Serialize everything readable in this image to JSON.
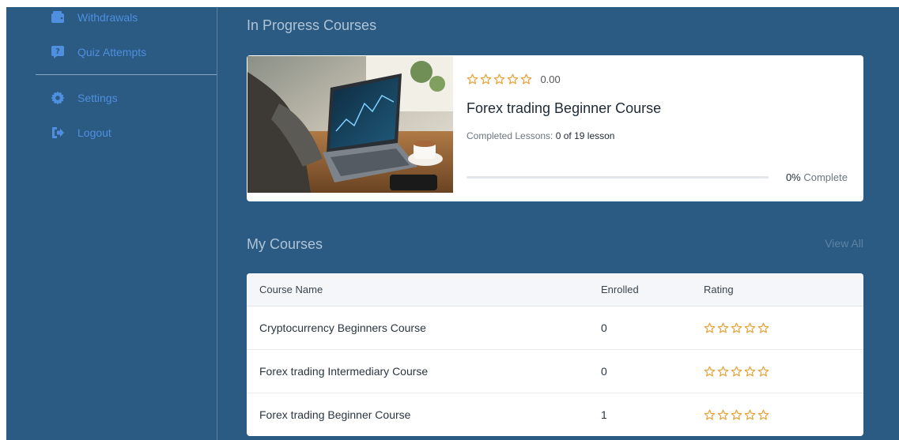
{
  "sidebar": {
    "items": [
      {
        "label": "Withdrawals",
        "icon": "wallet-icon"
      },
      {
        "label": "Quiz Attempts",
        "icon": "quiz-icon"
      },
      {
        "label": "Settings",
        "icon": "gear-icon"
      },
      {
        "label": "Logout",
        "icon": "logout-icon"
      }
    ]
  },
  "in_progress": {
    "title": "In Progress Courses",
    "course": {
      "rating_stars": 0,
      "rating_value": "0.00",
      "title": "Forex trading Beginner Course",
      "lessons_label": "Completed Lessons:",
      "lessons_value": "0 of 19 lesson",
      "progress_percent": 0,
      "progress_pct_text": "0%",
      "progress_suffix": "Complete"
    }
  },
  "my_courses": {
    "title": "My Courses",
    "view_all": "View All",
    "columns": [
      "Course Name",
      "Enrolled",
      "Rating"
    ],
    "rows": [
      {
        "name": "Cryptocurrency Beginners Course",
        "enrolled": "0",
        "stars": 0
      },
      {
        "name": "Forex trading Intermediary Course",
        "enrolled": "0",
        "stars": 0
      },
      {
        "name": "Forex trading Beginner Course",
        "enrolled": "1",
        "stars": 0
      }
    ]
  },
  "colors": {
    "background": "#2b5a82",
    "nav_text": "#4e8fe0",
    "star": "#e8a33a",
    "progress": "#3e64de"
  }
}
